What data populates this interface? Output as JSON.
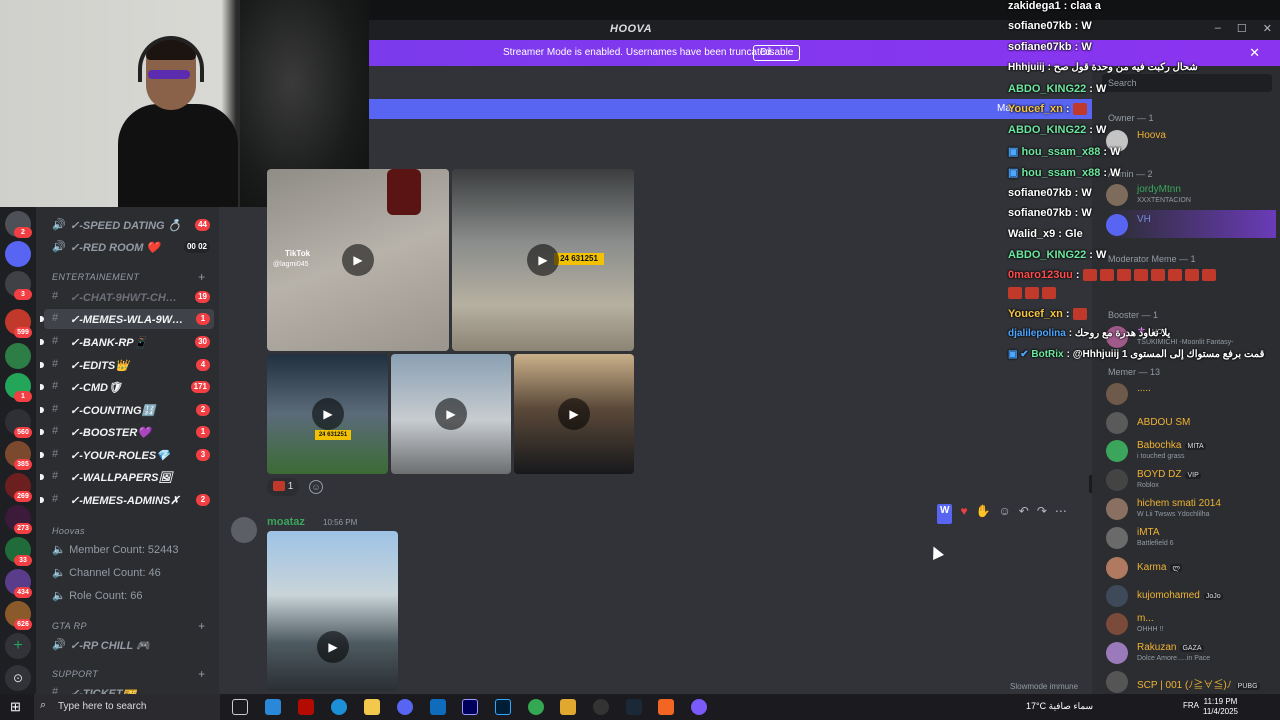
{
  "window": {
    "title": "HOOVA",
    "controls": [
      "–",
      "☐",
      "✕"
    ]
  },
  "streamer": {
    "message": "Streamer Mode is enabled. Usernames have been truncated.",
    "button": "Disable",
    "close": "✕"
  },
  "highlight_bar_label": "Ma",
  "rail": {
    "badges": [
      "2",
      "3",
      "599",
      "1",
      "560",
      "385",
      "269",
      "273",
      "33",
      "434",
      "626"
    ]
  },
  "channels": {
    "items_top": [
      {
        "name": "✓-SPEED DATING 💍",
        "count": "44"
      },
      {
        "name": "✓-RED ROOM ❤️",
        "count": "00 02"
      }
    ],
    "cat_entertainement": "ENTERTAINEMENT",
    "entertainement": [
      {
        "name": "✓-CHAT-9HWT-CH…",
        "count": "19"
      },
      {
        "name": "✓-MEMES-WLA-9W…",
        "count": "1"
      },
      {
        "name": "✓-BANK-RP📱",
        "count": "30"
      },
      {
        "name": "✓-EDITS👑",
        "count": "4"
      },
      {
        "name": "✓-CMD🛡",
        "count": "171"
      },
      {
        "name": "✓-COUNTING🔢",
        "count": "2"
      },
      {
        "name": "✓-BOOSTER💜",
        "count": "1"
      },
      {
        "name": "✓-YOUR-ROLES💎",
        "count": "3"
      },
      {
        "name": "✓-WALLPAPERS🖼",
        "count": ""
      },
      {
        "name": "✓-MEMES-ADMINS✗",
        "count": "2"
      }
    ],
    "cat_hoovas": "Hoovas",
    "stats": [
      {
        "label": "Member Count: 52443"
      },
      {
        "label": "Channel Count: 46"
      },
      {
        "label": "Role Count: 66"
      }
    ],
    "cat_gtarp": "GTA RP",
    "gtarp": [
      {
        "name": "✓-RP CHILL 🎮"
      }
    ],
    "cat_support": "SUPPORT",
    "support": [
      {
        "name": "✓-TICKET🎫"
      }
    ]
  },
  "messages": {
    "tiktok_label": "TikTok",
    "tiktok_user": "@lagmi045",
    "plate_1": "24 631251",
    "plate_2": "24 631251",
    "reaction_count": "1",
    "author": "moataz",
    "timestamp": "10:56 PM",
    "slowmode": "Slowmode immune"
  },
  "members": {
    "search_placeholder": "Search",
    "sections": {
      "owner": "Owner — 1",
      "admin": "Admin — 2",
      "moderator": "Moderator Meme — 1",
      "booster": "Booster — 1",
      "memer": "Memer — 13"
    },
    "owner": [
      {
        "name": "Hoova",
        "color": "#f0b232"
      }
    ],
    "admin": [
      {
        "name": "jordyMtnn",
        "sub": "XXXTENTACION",
        "color": "#3ba55c"
      },
      {
        "name": "VH",
        "sub": "",
        "color": "#7289da"
      }
    ],
    "booster": [
      {
        "name": "⚜",
        "sub": "TSUKIMICHI -Moonlit Fantasy-",
        "tag": "HOT"
      }
    ],
    "memer": [
      {
        "name": ".....",
        "sub": "",
        "tag": ""
      },
      {
        "name": "ABDOU SM",
        "sub": "",
        "tag": ""
      },
      {
        "name": "Babochka",
        "sub": "i touched grass",
        "tag": "MITA"
      },
      {
        "name": "BOYD DZ",
        "sub": "Roblox",
        "tag": "VIP"
      },
      {
        "name": "hichem smati 2014",
        "sub": "W Lii Twsws Ydochlilha",
        "tag": ""
      },
      {
        "name": "iMTA",
        "sub": "Battlefield 6",
        "tag": ""
      },
      {
        "name": "Karma",
        "sub": "",
        "tag": "ლ"
      },
      {
        "name": "kujomohamed",
        "sub": "",
        "tag": "JoJo"
      },
      {
        "name": "m...",
        "sub": "OHHH !!",
        "tag": ""
      },
      {
        "name": "Rakuzan",
        "sub": "Dolce Amore.....in Pace",
        "tag": "GAZA"
      },
      {
        "name": "SCP | 001 (ﾉ≧∀≦)ﾉ",
        "sub": "",
        "tag": "PUBG"
      }
    ]
  },
  "chat": [
    {
      "user": "zakidega1",
      "msg": ": claa a",
      "color": "#ffffff"
    },
    {
      "user": "sofiane07kb",
      "msg": ": W",
      "color": "#ffffff"
    },
    {
      "user": "sofiane07kb",
      "msg": ": W",
      "color": "#ffffff"
    },
    {
      "user": "Hhhjuiij",
      "msg": ": شحال ركبت فيه من وحدة قول صح",
      "color": "#ffffff"
    },
    {
      "user": "ABDO_KING22",
      "msg": ": W",
      "color": "#6ee7a0"
    },
    {
      "user": "Youcef_xn",
      "msg": ":",
      "color": "#f5c542"
    },
    {
      "user": "ABDO_KING22",
      "msg": ": W",
      "color": "#6ee7a0"
    },
    {
      "user": "hou_ssam_x88",
      "msg": ": W",
      "color": "#6ee7a0"
    },
    {
      "user": "hou_ssam_x88",
      "msg": ": W",
      "color": "#6ee7a0"
    },
    {
      "user": "sofiane07kb",
      "msg": ": W",
      "color": "#ffffff"
    },
    {
      "user": "sofiane07kb",
      "msg": ": W",
      "color": "#ffffff"
    },
    {
      "user": "Walid_x9",
      "msg": ": Gle",
      "color": "#ffffff"
    },
    {
      "user": "ABDO_KING22",
      "msg": ": W",
      "color": "#6ee7a0"
    },
    {
      "user": "0maro123uu",
      "msg": ":",
      "color": "#ff4d4d"
    },
    {
      "user": "",
      "msg": "",
      "color": "#ffffff"
    },
    {
      "user": "Youcef_xn",
      "msg": ":",
      "color": "#f5c542"
    },
    {
      "user": "djalilepolina",
      "msg": ": يلا نعاود هدرة مع روحك",
      "color": "#4da6ff"
    },
    {
      "user": "BotRix",
      "msg": ": @Hhhjuiij 1 قمت برفع مستواك إلى المستوى",
      "color": "#6ee7a0"
    }
  ],
  "taskbar": {
    "search_placeholder": "Type here to search",
    "weather": "17°C  سماء صافية",
    "lang": "FRA",
    "time": "11:19 PM",
    "date": "11/4/2025"
  }
}
